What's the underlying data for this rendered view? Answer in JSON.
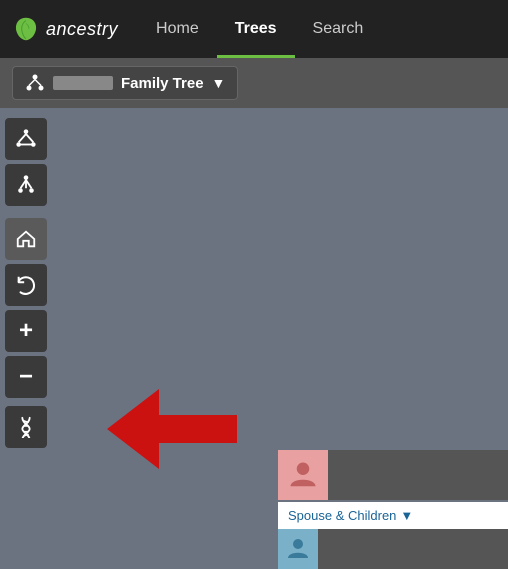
{
  "navbar": {
    "logo_text": "ancestry",
    "links": [
      {
        "label": "Home",
        "active": false
      },
      {
        "label": "Trees",
        "active": true
      },
      {
        "label": "Search",
        "active": false
      }
    ]
  },
  "tree_header": {
    "tree_label": "Family Tree",
    "chevron": "▼"
  },
  "toolbar": {
    "buttons": [
      {
        "name": "network-btn",
        "tooltip": "Network view"
      },
      {
        "name": "fork-btn",
        "tooltip": "List view"
      },
      {
        "name": "home-btn",
        "tooltip": "Home person"
      },
      {
        "name": "undo-btn",
        "tooltip": "Undo"
      },
      {
        "name": "zoom-in-btn",
        "tooltip": "Zoom in"
      },
      {
        "name": "zoom-out-btn",
        "tooltip": "Zoom out"
      },
      {
        "name": "dna-btn",
        "tooltip": "DNA"
      }
    ]
  },
  "person_card": {
    "spouse_children_label": "Spouse & Children",
    "chevron": "▼"
  },
  "arrow": {
    "color": "#cc1111"
  }
}
